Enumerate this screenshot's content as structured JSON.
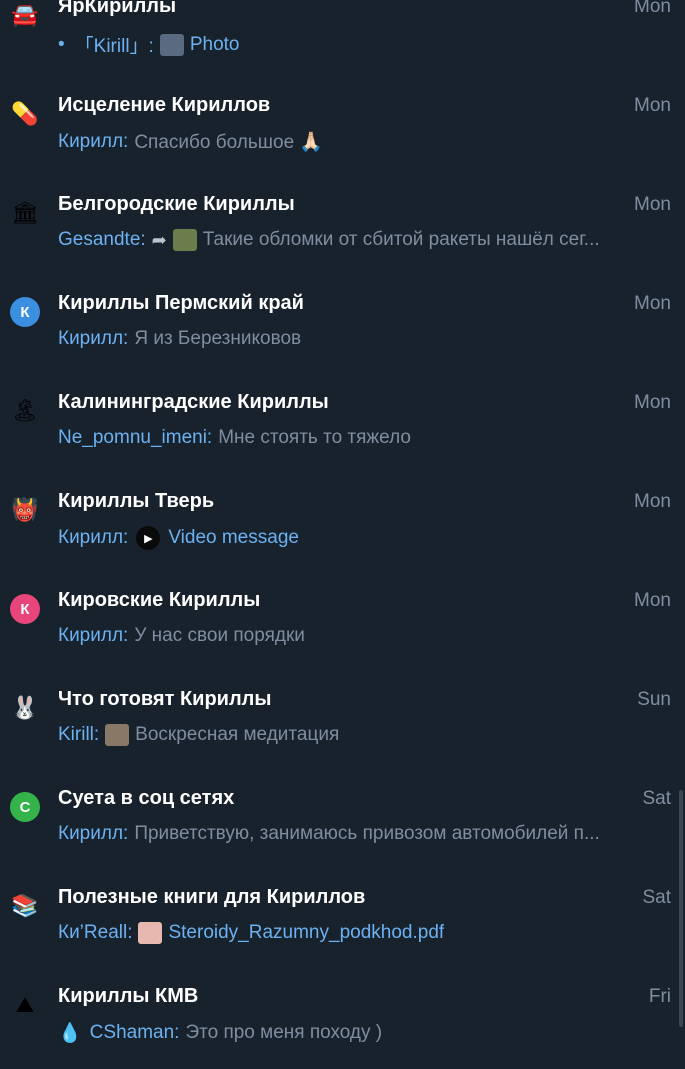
{
  "chats": [
    {
      "icon": "car-icon",
      "glyph": "🚘",
      "title": "ЯрКириллы",
      "date": "Mon",
      "bullet": "•",
      "sender": "「Kirill」:",
      "thumb_color": "#5a6a80",
      "text": "Photo",
      "text_is_link": true
    },
    {
      "icon": "pill-icon",
      "glyph": "💊",
      "title": "Исцеление Кириллов",
      "date": "Mon",
      "sender": "Кирилл:",
      "text": "Спасибо большое 🙏🏻"
    },
    {
      "icon": "building-icon",
      "glyph": "🏛",
      "title": "Белгородские Кириллы",
      "date": "Mon",
      "sender": "Gesandte:",
      "arrow": "➦",
      "thumb_color": "#6b7d4a",
      "text": "Такие обломки от сбитой ракеты нашёл сег..."
    },
    {
      "icon": "letter-k-avatar",
      "letter": "К",
      "avatar_color": "#3a8fe0",
      "title": "Кириллы Пермский край",
      "date": "Mon",
      "sender": "Кирилл:",
      "text": "Я из Березниковов"
    },
    {
      "icon": "beach-icon",
      "glyph": "🏝",
      "title": "Калининградские Кириллы",
      "date": "Mon",
      "sender": "Ne_pomnu_imeni:",
      "text": "Мне стоять то тяжело"
    },
    {
      "icon": "anime-avatar-icon",
      "glyph": "👹",
      "title": "Кириллы Тверь",
      "date": "Mon",
      "sender": "Кирилл:",
      "play": "▶",
      "text": "Video message",
      "text_is_link": true
    },
    {
      "icon": "letter-k-avatar",
      "letter": "К",
      "avatar_color": "#e8457a",
      "title": "Кировские Кириллы",
      "date": "Mon",
      "sender": "Кирилл:",
      "text": "У нас свои порядки"
    },
    {
      "icon": "bunny-icon",
      "glyph": "🐰",
      "title": "Что готовят Кириллы",
      "date": "Sun",
      "sender": "Kirill:",
      "thumb_color": "#8a7866",
      "text": "Воскресная медитация"
    },
    {
      "icon": "letter-c-avatar",
      "letter": "С",
      "avatar_color": "#34b34a",
      "title": "Суета в соц сетях",
      "date": "Sat",
      "sender": "Кирилл:",
      "text": "Приветствую, занимаюсь привозом автомобилей п..."
    },
    {
      "icon": "books-icon",
      "glyph": "📚",
      "title": "Полезные книги для Кириллов",
      "date": "Sat",
      "sender": "Ки’Reall:",
      "thumb_color": "#e6b8b0",
      "text": "Steroidy_Razumny_podkhod.pdf",
      "text_is_link": true
    },
    {
      "icon": "mountain-icon",
      "glyph": "⛰",
      "title": "Кириллы КМВ",
      "date": "Fri",
      "drop": "💧",
      "sender": "CShaman:",
      "text": "Это про меня походу )"
    }
  ]
}
